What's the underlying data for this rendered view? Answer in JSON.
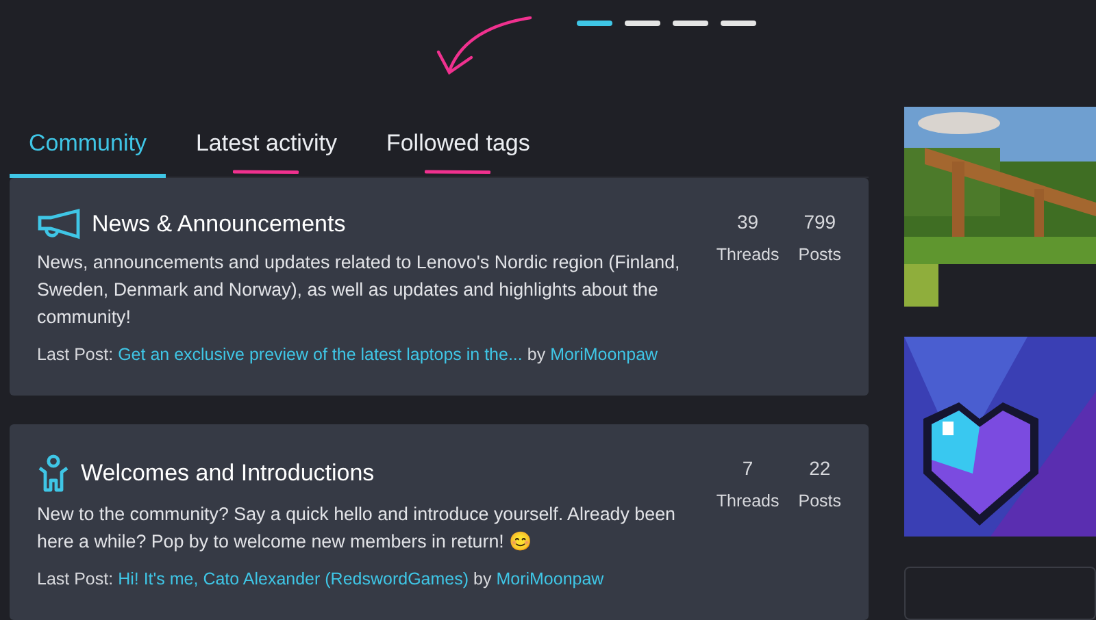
{
  "carousel": {
    "dots": [
      {
        "selected": true
      },
      {
        "selected": false
      },
      {
        "selected": false
      },
      {
        "selected": false
      }
    ]
  },
  "tabs": [
    {
      "label": "Community",
      "selected": true,
      "annotated": false
    },
    {
      "label": "Latest activity",
      "selected": false,
      "annotated": true
    },
    {
      "label": "Followed tags",
      "selected": false,
      "annotated": true
    }
  ],
  "forums": [
    {
      "kind": "megaphone",
      "title": "News & Announcements",
      "description": "News, announcements and updates related to Lenovo's Nordic region (Finland, Sweden, Denmark and Norway), as well as updates and highlights about the community!",
      "last_post_label": "Last Post:",
      "last_post": "Get an exclusive preview of the latest laptops in the...",
      "by": "by",
      "author": "MoriMoonpaw",
      "threads": "39",
      "threads_label": "Threads",
      "posts": "799",
      "posts_label": "Posts"
    },
    {
      "kind": "person",
      "title": "Welcomes and Introductions",
      "description": "New to the community? Say a quick hello and introduce yourself. Already been here a while? Pop by to welcome new members in return! 😊",
      "last_post_label": "Last Post:",
      "last_post": "Hi! It's me, Cato Alexander (RedswordGames)",
      "by": "by",
      "author": "MoriMoonpaw",
      "threads": "7",
      "threads_label": "Threads",
      "posts": "22",
      "posts_label": "Posts"
    }
  ]
}
